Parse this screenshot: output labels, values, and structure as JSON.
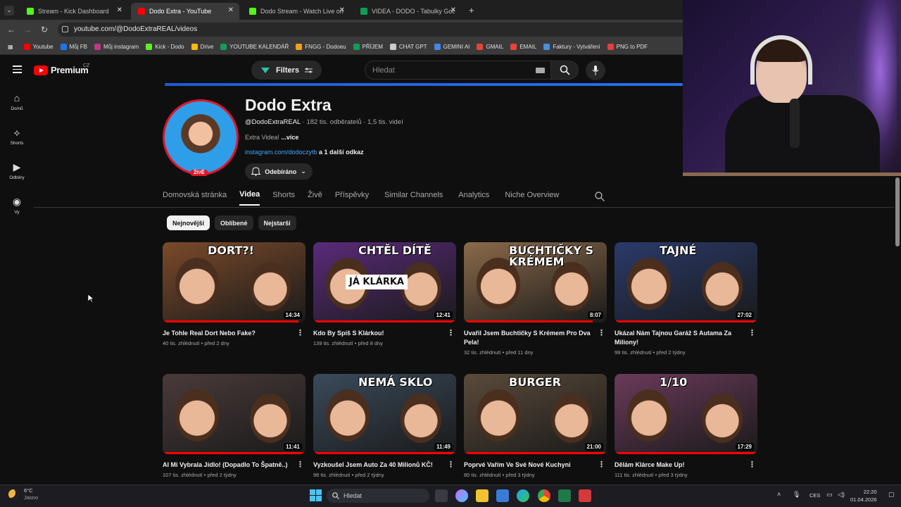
{
  "browser": {
    "tabs": [
      {
        "label": "Stream - Kick Dashboard",
        "color": "#53fc18",
        "active": false
      },
      {
        "label": "Dodo Extra - YouTube",
        "color": "#ff0000",
        "active": true
      },
      {
        "label": "Dodo Stream - Watch Live on K",
        "color": "#53fc18",
        "active": false
      },
      {
        "label": "VIDEA - DODO - Tabulky Googl",
        "color": "#0f9d58",
        "active": false
      }
    ],
    "new_tab": "+",
    "url": "youtube.com/@DodoExtraREAL/videos",
    "bookmarks": [
      {
        "label": "Youtube",
        "color": "#ff0000"
      },
      {
        "label": "Můj FB",
        "color": "#1877f2"
      },
      {
        "label": "Můj instagram",
        "color": "#c13584"
      },
      {
        "label": "Kick - Dodo",
        "color": "#53fc18"
      },
      {
        "label": "Drive",
        "color": "#fbbc04"
      },
      {
        "label": "YOUTUBE KALENDÁŘ",
        "color": "#0f9d58"
      },
      {
        "label": "FNGG - Dodoeu",
        "color": "#f0a020"
      },
      {
        "label": "PŘÍJEM",
        "color": "#0f9d58"
      },
      {
        "label": "CHAT GPT",
        "color": "#cccccc"
      },
      {
        "label": "GEMINI AI",
        "color": "#4285f4"
      },
      {
        "label": "GMAIL",
        "color": "#ea4335"
      },
      {
        "label": "EMAIL",
        "color": "#ea4335"
      },
      {
        "label": "Faktury - Vytváření",
        "color": "#4a90d9"
      },
      {
        "label": "PNG to PDF",
        "color": "#e04040"
      }
    ]
  },
  "youtube": {
    "logo_text": "Premium",
    "logo_country": "CZ",
    "filters_label": "Filters",
    "search_placeholder": "Hledat",
    "rail": [
      {
        "label": "Domů",
        "icon": "home-icon"
      },
      {
        "label": "Shorts",
        "icon": "shorts-icon"
      },
      {
        "label": "Odběry",
        "icon": "subscriptions-icon"
      },
      {
        "label": "Vy",
        "icon": "you-icon"
      }
    ]
  },
  "channel": {
    "name": "Dodo Extra",
    "handle": "@DodoExtraREAL",
    "stats": " · 182 tis. odběratelů · 1,5 tis. videí",
    "description": "Extra Videa! ",
    "description_more": "...více",
    "link": "instagram.com/dodoczytb",
    "link_more": " a 1 další odkaz",
    "subscribe_label": "Odebíráno",
    "live_badge": "ŽIVĚ"
  },
  "channel_tabs": [
    {
      "label": "Domovská stránka",
      "active": false
    },
    {
      "label": "Videa",
      "active": true
    },
    {
      "label": "Shorts",
      "active": false
    },
    {
      "label": "Živě",
      "active": false
    },
    {
      "label": "Příspěvky",
      "active": false
    },
    {
      "label": "Similar Channels",
      "active": false,
      "ext": true
    },
    {
      "label": "Analytics",
      "active": false,
      "ext": true
    },
    {
      "label": "Niche Overview",
      "active": false,
      "ext": true
    }
  ],
  "chips": [
    {
      "label": "Nejnovější",
      "active": true
    },
    {
      "label": "Oblíbené",
      "active": false
    },
    {
      "label": "Nejstarší",
      "active": false
    }
  ],
  "videos": [
    {
      "title": "Je Tohle Real Dort Nebo Fake?",
      "meta": "40 tis. zhlédnutí • před 2 dny",
      "duration": "14:34",
      "overlay": "DORT?!",
      "watched": 0.95,
      "bg": "#7a4a2a"
    },
    {
      "title": "Kdo By Spíš S Klárkou!",
      "meta": "139 tis. zhlédnutí • před 8 dny",
      "duration": "12:41",
      "overlay": "CHTĚL DÍTĚ",
      "overlay2": "JÁ   KLÁRKA",
      "watched": 1.0,
      "bg": "#5a2a7a"
    },
    {
      "title": "Uvařil Jsem Buchtičky S Krémem Pro Dva Pela!",
      "meta": "32 tis. zhlédnutí • před 11 dny",
      "duration": "8:07",
      "overlay": "BUCHTIČKY S KRÉMEM",
      "watched": 0.9,
      "bg": "#8a6a4a"
    },
    {
      "title": "Ukázal Nám Tajnou Garáž S Autama Za Miliony!",
      "meta": "99 tis. zhlédnutí • před 2 týdny",
      "duration": "27:02",
      "overlay": "TAJNÉ",
      "watched": 1.0,
      "bg": "#2a3a6a"
    },
    {
      "title": "AI Mi Vybrala Jídlo! (Dopadlo To Špatně..)",
      "meta": "107 tis. zhlédnutí • před 2 týdny",
      "duration": "11:41",
      "overlay": "",
      "watched": 1.0,
      "bg": "#4a3a3a"
    },
    {
      "title": "Vyzkoušel Jsem Auto Za 40 Milionů KČ!",
      "meta": "98 tis. zhlédnutí • před 2 týdny",
      "duration": "11:49",
      "overlay": "NEMÁ SKLO",
      "watched": 1.0,
      "bg": "#3a4a5a"
    },
    {
      "title": "Poprvé Vařím Ve Své Nové Kuchyni",
      "meta": "80 tis. zhlédnutí • před 3 týdny",
      "duration": "21:00",
      "overlay": "BURGER",
      "watched": 1.0,
      "bg": "#5a4a3a"
    },
    {
      "title": "Dělám Klárce Make Up!",
      "meta": "111 tis. zhlédnutí • před 3 týdny",
      "duration": "17:29",
      "overlay": "1/10",
      "watched": 1.0,
      "bg": "#6a3a5a"
    }
  ],
  "taskbar": {
    "temperature": "6°C",
    "weather": "Jasno",
    "search": "Hledat",
    "lang": "CES",
    "time": "22:20",
    "date": "01.04.2026"
  }
}
